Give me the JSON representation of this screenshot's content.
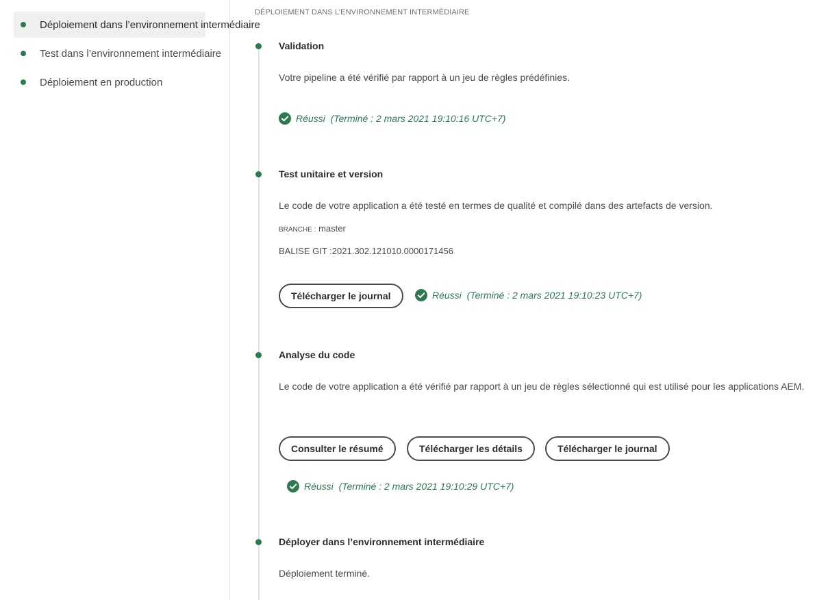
{
  "sidebar": {
    "items": [
      {
        "label": "Déploiement dans l’environnement intermédiaire",
        "active": true
      },
      {
        "label": "Test dans l’environnement intermédiaire",
        "active": false
      },
      {
        "label": "Déploiement en production",
        "active": false
      }
    ]
  },
  "main": {
    "section_title": "DÉPLOIEMENT DANS L’ENVIRONNEMENT INTERMÉDIAIRE",
    "steps": [
      {
        "title": "Validation",
        "description": "Votre pipeline a été vérifié par rapport à un jeu de règles prédéfinies.",
        "status": "Réussi",
        "completed": "(Terminé : 2 mars 2021 19:10:16 UTC+7)"
      },
      {
        "title": "Test unitaire et version",
        "description": "Le code de votre application a été testé en termes de qualité et compilé dans des artefacts de version.",
        "branch_label": "BRANCHE :",
        "branch_value": "master",
        "git_tag_label": "BALISE GIT :",
        "git_tag_value": "2021.302.121010.0000171456",
        "buttons": [
          "Télécharger le journal"
        ],
        "status": "Réussi",
        "completed": "(Terminé : 2 mars 2021 19:10:23 UTC+7)"
      },
      {
        "title": "Analyse du code",
        "description": "Le code de votre application a été vérifié par rapport à un jeu de règles sélectionné qui est utilisé pour les applications AEM.",
        "buttons": [
          "Consulter le résumé",
          "Télécharger les détails",
          "Télécharger le journal"
        ],
        "status": "Réussi",
        "completed": "(Terminé : 2 mars 2021 19:10:29 UTC+7)"
      },
      {
        "title": "Déployer dans l’environnement intermédiaire",
        "description": "Déploiement terminé."
      }
    ]
  },
  "colors": {
    "success": "#2d7a4f",
    "active_bg": "#efefef",
    "divider": "#e1e1e1"
  }
}
